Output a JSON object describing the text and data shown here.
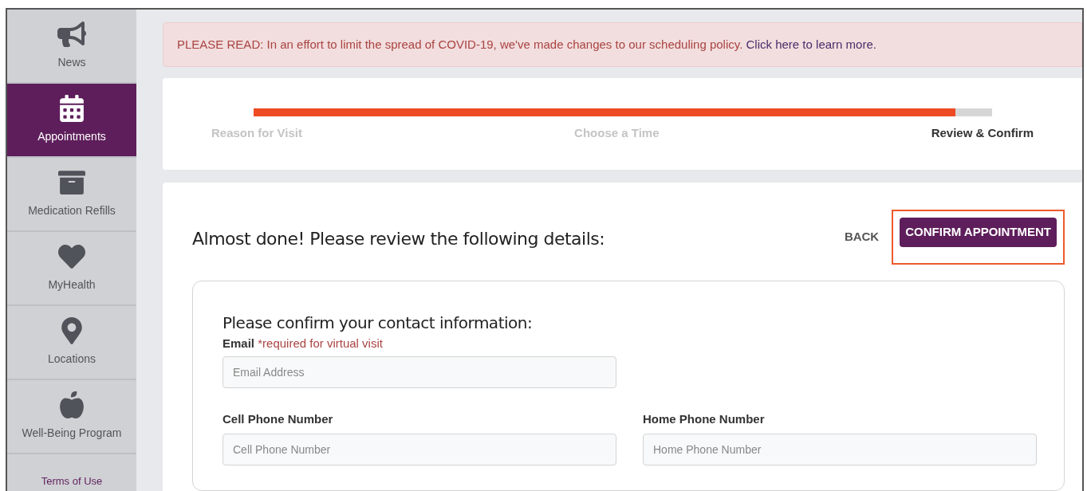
{
  "sidebar": {
    "items": [
      {
        "label": "News",
        "selected": false
      },
      {
        "label": "Appointments",
        "selected": true
      },
      {
        "label": "Medication Refills",
        "selected": false
      },
      {
        "label": "MyHealth",
        "selected": false
      },
      {
        "label": "Locations",
        "selected": false
      },
      {
        "label": "Well-Being Program",
        "selected": false
      }
    ],
    "footer_link": "Terms of Use"
  },
  "banner": {
    "text": "PLEASE READ: In an effort to limit the spread of COVID-19, we've made changes to our scheduling policy.",
    "link": "Click here to learn more."
  },
  "progress": {
    "level": 0.95,
    "steps": [
      {
        "label": "Reason for Visit",
        "selected": false
      },
      {
        "label": "Choose a Time",
        "selected": false
      },
      {
        "label": "Review & Confirm",
        "selected": true
      }
    ]
  },
  "review": {
    "heading": "Almost done! Please review the following details:",
    "back_button": "BACK",
    "confirm_button": "CONFIRM APPOINTMENT",
    "contact": {
      "heading": "Please confirm your contact information:",
      "email": {
        "label": "Email",
        "note": "*required for virtual visit",
        "placeholder": "Email Address"
      },
      "phones": [
        {
          "label": "Cell Phone Number",
          "placeholder": "Cell Phone Number"
        },
        {
          "label": "Home Phone Number",
          "placeholder": "Home Phone Number"
        }
      ]
    }
  }
}
